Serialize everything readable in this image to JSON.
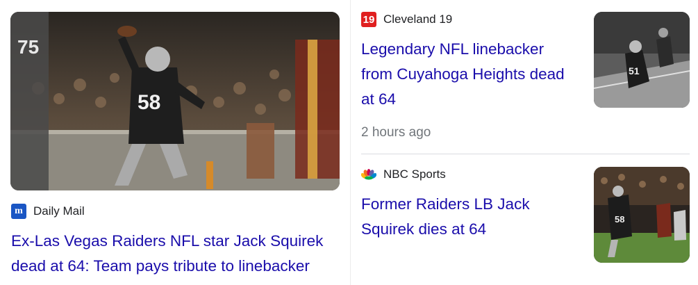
{
  "articles": [
    {
      "source": "Daily Mail",
      "source_icon": "daily-mail-logo-icon",
      "title": "Ex-Las Vegas Raiders NFL star Jack Squirek dead at 64: Team pays tribute to linebacker",
      "jersey": "58"
    },
    {
      "source": "Cleveland 19",
      "source_icon": "cleveland-19-logo-icon",
      "logo_text": "19",
      "title": "Legendary NFL linebacker from Cuyahoga Heights dead at 64",
      "time": "2 hours ago",
      "jersey": "51"
    },
    {
      "source": "NBC Sports",
      "source_icon": "nbc-peacock-logo-icon",
      "title": "Former Raiders LB Jack Squirek dies at 64",
      "jersey": "58"
    }
  ],
  "colors": {
    "link": "#1a0dab",
    "meta": "#70757a",
    "cleveland_red": "#e02020",
    "dailymail_blue": "#1a56c4"
  }
}
